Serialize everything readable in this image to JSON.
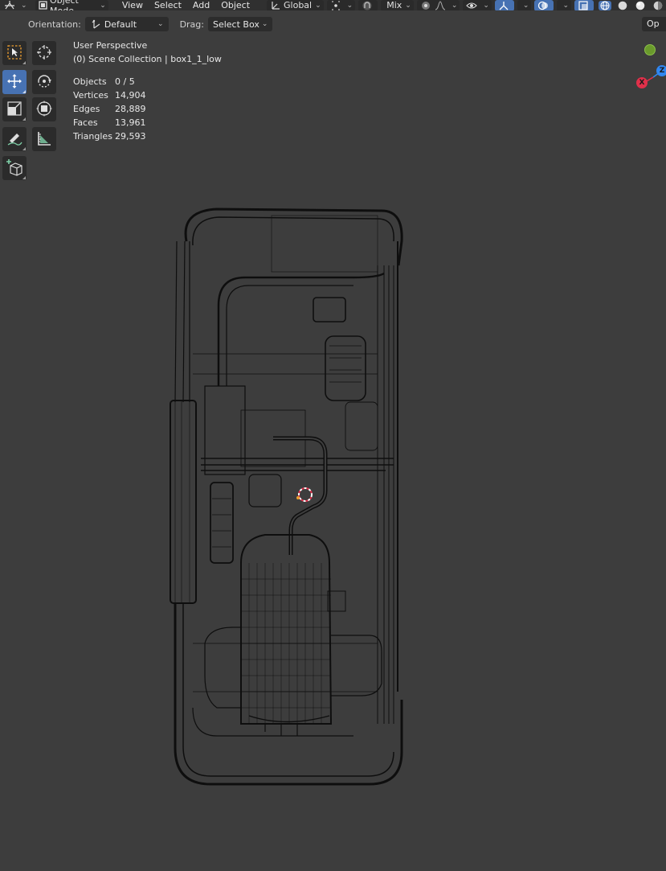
{
  "header": {
    "mode_label": "Object Mode",
    "menus": [
      "View",
      "Select",
      "Add",
      "Object"
    ],
    "transform_orientation": "Global",
    "proportional_label": "Mix"
  },
  "tool_settings": {
    "orientation_label": "Orientation:",
    "orientation_value": "Default",
    "drag_label": "Drag:",
    "drag_value": "Select Box",
    "options_label": "Op"
  },
  "viewport": {
    "perspective": "User Perspective",
    "collection": "(0) Scene Collection | box1_1_low",
    "stats": [
      {
        "label": "Objects",
        "value": "0 / 5"
      },
      {
        "label": "Vertices",
        "value": "14,904"
      },
      {
        "label": "Edges",
        "value": "28,889"
      },
      {
        "label": "Faces",
        "value": "13,961"
      },
      {
        "label": "Triangles",
        "value": "29,593"
      }
    ]
  },
  "gizmo": {
    "z_label": "Z",
    "x_label": "X",
    "colors": {
      "x": "#e0304a",
      "y": "#6a9a2c",
      "z": "#2f86f0"
    }
  },
  "colors": {
    "background": "#3d3d3d",
    "header": "#303030",
    "active_tool": "#4772b3",
    "wireframe": "#0a0a0a"
  },
  "tools": [
    "select-box",
    "cursor",
    "move",
    "rotate",
    "scale",
    "transform",
    "annotate",
    "measure",
    "add-cube"
  ]
}
